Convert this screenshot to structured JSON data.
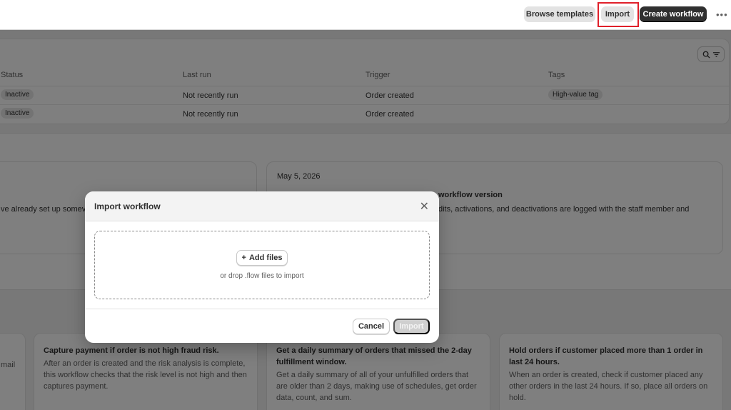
{
  "topbar": {
    "browse_templates": "Browse templates",
    "import": "Import",
    "create_workflow": "Create workflow",
    "more": "•••"
  },
  "table": {
    "headers": {
      "status": "Status",
      "last_run": "Last run",
      "trigger": "Trigger",
      "tags": "Tags"
    },
    "rows": [
      {
        "status": "Inactive",
        "last_run": "Not recently run",
        "trigger": "Order created",
        "tag": "High-value tag"
      },
      {
        "status": "Inactive",
        "last_run": "Not recently run",
        "trigger": "Order created",
        "tag": ""
      }
    ]
  },
  "news": {
    "left_body": "ve already set up somev",
    "date": "May 5, 2026",
    "heading": "workflow version",
    "right_body": "dits, activations, and deactivations are logged with the staff member and"
  },
  "templates": [
    {
      "title": "",
      "desc": "mail"
    },
    {
      "title": "Capture payment if order is not high fraud risk.",
      "desc": "After an order is created and the risk analysis is complete, this workflow checks that the risk level is not high and then captures payment."
    },
    {
      "title": "Get a daily summary of orders that missed the 2-day fulfillment window.",
      "desc": "Get a daily summary of all of your unfulfilled orders that are older than 2 days, making use of schedules, get order data, count, and sum."
    },
    {
      "title": "Hold orders if customer placed more than 1 order in last 24 hours.",
      "desc": "When an order is created, check if customer placed any other orders in the last 24 hours. If so, place all orders on hold."
    }
  ],
  "modal": {
    "title": "Import workflow",
    "add_files": "Add files",
    "drop_hint": "or drop .flow files to import",
    "cancel": "Cancel",
    "import": "Import"
  },
  "icons": {
    "close": "close-icon",
    "plus": "plus-icon",
    "search": "search-icon",
    "filter": "filter-icon"
  },
  "colors": {
    "highlight": "#e0202a",
    "primary_button": "#303030"
  }
}
